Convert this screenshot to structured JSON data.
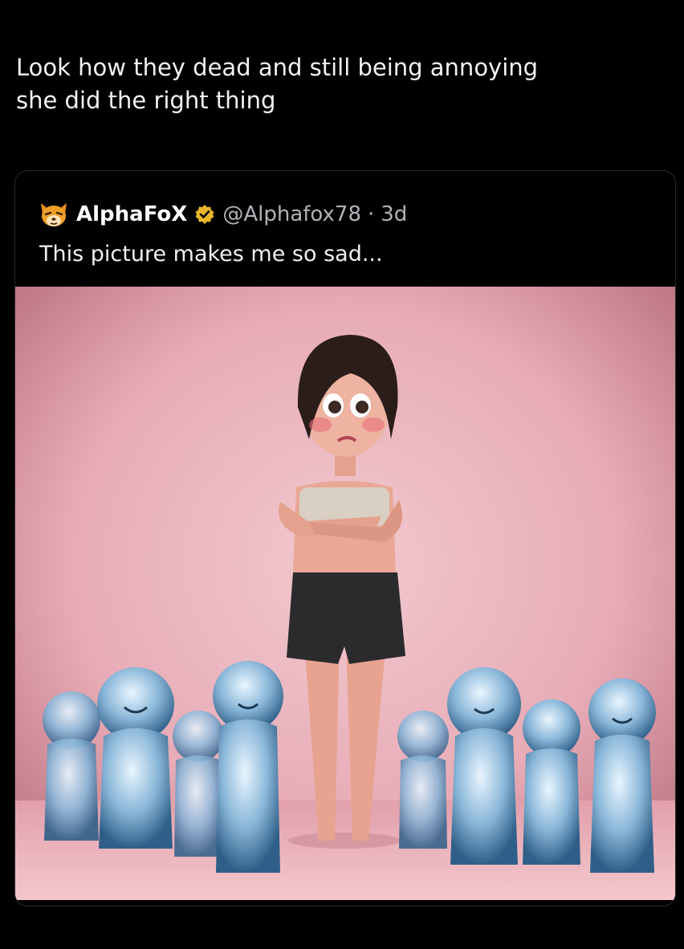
{
  "post": {
    "line1": "Look how they dead and still being annoying",
    "line2": "she did the right thing"
  },
  "quote": {
    "display_name": "AlphaFoX",
    "handle": "@Alphafox78",
    "dot": "·",
    "age": "3d",
    "text": "This picture makes me so sad...",
    "avatar_icon": "fox-face-icon",
    "verified_icon": "verified-badge-icon",
    "colors": {
      "verified": "#E9B52A",
      "background": "#000000",
      "image_backdrop": "#E9AEB8"
    }
  },
  "image": {
    "subject": "animated woman with arms crossed surrounded by ghostly crying babies"
  }
}
